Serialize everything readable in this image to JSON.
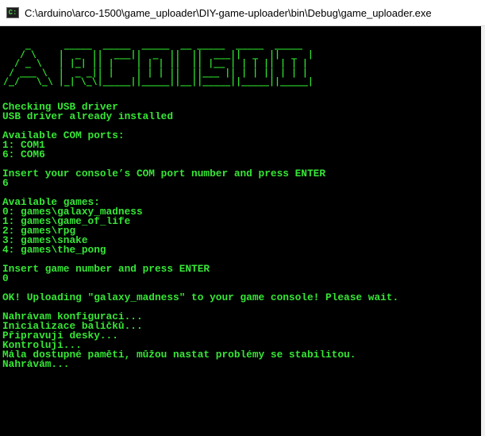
{
  "window": {
    "title": "C:\\arduino\\arco-1500\\game_uploader\\DIY-game-uploader\\bin\\Debug\\game_uploader.exe",
    "icon": "console-app-icon",
    "icon_glyph": "C:"
  },
  "console": {
    "text_color": "#36e636",
    "background": "#000000",
    "banner_color": "#2ee02e",
    "banner": [
      "    _      _____  _____  _____  __ _____  _____  _____ ",
      "   / \\    |  _  ||  ___||  _  ||  ||  ___||  _  ||  _  |",
      "  / _ \\   | |_| || |    | | | ||  || |__ | | | || | | |",
      " / ___ \\  |  _ _|| |    | | | ||  ||___ || | | || | | |",
      "/_/   \\_\\ |_| \\_\\|_____||_____||__||_____||_____||_____|"
    ],
    "lines": [
      "Checking USB driver",
      "USB driver already installed",
      "",
      "Available COM ports:",
      "1: COM1",
      "6: COM6",
      "",
      "Insert your console’s COM port number and press ENTER",
      "6",
      "",
      "Available games:",
      "0: games\\galaxy_madness",
      "1: games\\game_of_life",
      "2: games\\rpg",
      "3: games\\snake",
      "4: games\\the_pong",
      "",
      "Insert game number and press ENTER",
      "0",
      "",
      "OK! Uploading \"galaxy_madness\" to your game console! Please wait.",
      "",
      "Nahrávam konfiguraci...",
      "Inicializace balíčků...",
      "Připravuji desky...",
      "Kontroluji...",
      "Mála dostupné paměti, můžou nastat problémy se stabilitou.",
      "Nahrávám..."
    ]
  }
}
